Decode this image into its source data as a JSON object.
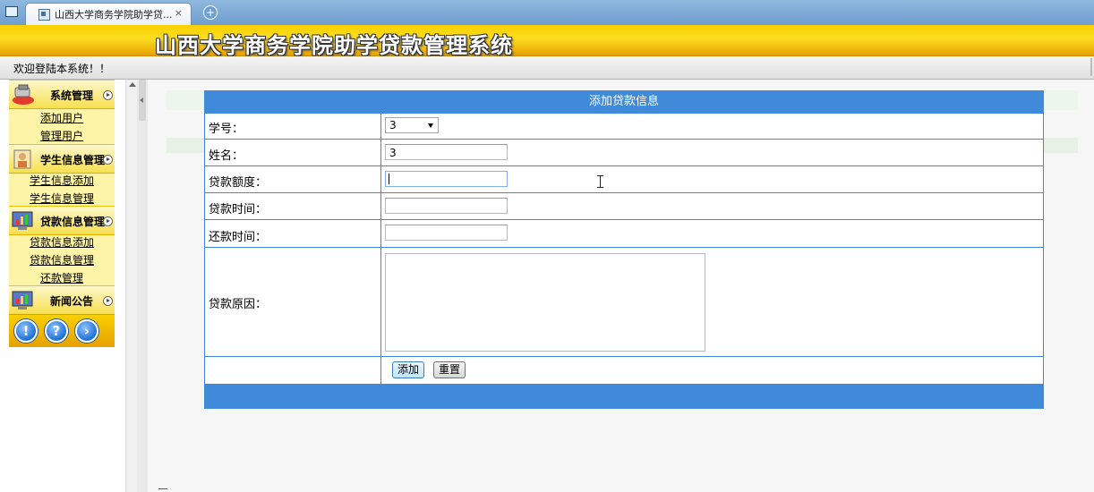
{
  "browser": {
    "tab_title": "山西大学商务学院助学贷...",
    "close_glyph": "×",
    "new_tab_glyph": "+"
  },
  "header": {
    "system_title": "山西大学商务学院助学贷款管理系统"
  },
  "welcome": {
    "text": "欢迎登陆本系统！！"
  },
  "sidebar": {
    "sections": [
      {
        "title": "系统管理",
        "icon": "tools-icon",
        "items": [
          "添加用户",
          "管理用户"
        ]
      },
      {
        "title": "学生信息管理",
        "icon": "student-icon",
        "items": [
          "学生信息添加",
          "学生信息管理"
        ]
      },
      {
        "title": "贷款信息管理",
        "icon": "monitor-chart-icon",
        "items": [
          "贷款信息添加",
          "贷款信息管理",
          "还款管理"
        ]
      },
      {
        "title": "新闻公告",
        "icon": "monitor-chart-icon",
        "items": []
      }
    ],
    "bottom_icons": [
      {
        "name": "info-icon",
        "glyph": "!"
      },
      {
        "name": "help-icon",
        "glyph": "?"
      },
      {
        "name": "forward-icon",
        "glyph": "›"
      }
    ]
  },
  "form": {
    "title": "添加贷款信息",
    "fields": {
      "student_id": {
        "label": "学号：",
        "value": "3"
      },
      "name": {
        "label": "姓名：",
        "value": "3"
      },
      "amount": {
        "label": "贷款额度：",
        "value": ""
      },
      "loan_date": {
        "label": "贷款时间：",
        "value": ""
      },
      "repay_date": {
        "label": "还款时间：",
        "value": ""
      },
      "reason": {
        "label": "贷款原因：",
        "value": ""
      }
    },
    "buttons": {
      "add": "添加",
      "reset": "重置"
    }
  },
  "colors": {
    "header_yellow": "#fcdd21",
    "form_blue": "#3f8bd9",
    "menu_bg": "#fdf4a8"
  }
}
